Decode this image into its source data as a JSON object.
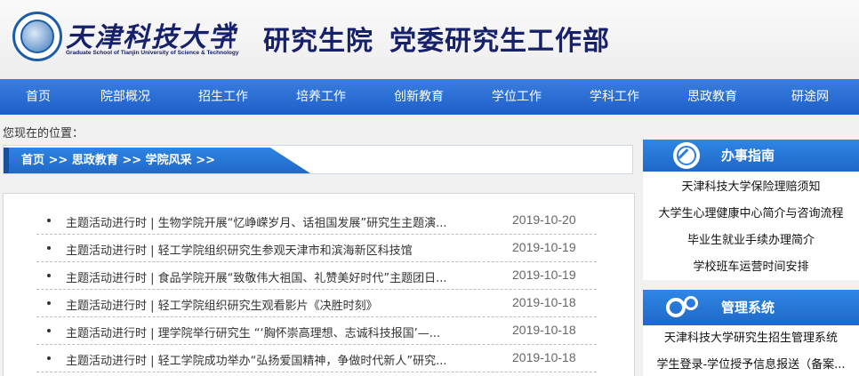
{
  "header": {
    "logo_text": "天津科技大学",
    "logo_subtitle": "Graduate School of Tianjin University of Science & Technology",
    "divider": "|",
    "site_title_1": "研究生院",
    "site_title_2": "党委研究生工作部"
  },
  "nav": {
    "items": [
      {
        "label": "首页"
      },
      {
        "label": "院部概况"
      },
      {
        "label": "招生工作"
      },
      {
        "label": "培养工作"
      },
      {
        "label": "创新教育"
      },
      {
        "label": "学位工作"
      },
      {
        "label": "学科工作"
      },
      {
        "label": "思政教育"
      },
      {
        "label": "研途网"
      }
    ]
  },
  "location": {
    "label": "您现在的位置："
  },
  "breadcrumb": {
    "text": "首页 >> 思政教育 >> 学院风采 >>"
  },
  "news": [
    {
      "title": "主题活动进行时 | 生物学院开展“忆峥嵘岁月、话祖国发展”研究生主题演...",
      "date": "2019-10-20"
    },
    {
      "title": "主题活动进行时 | 轻工学院组织研究生参观天津市和滨海新区科技馆",
      "date": "2019-10-19"
    },
    {
      "title": "主题活动进行时 | 食品学院开展“致敬伟大祖国、礼赞美好时代”主题团日...",
      "date": "2019-10-19"
    },
    {
      "title": "主题活动进行时 | 轻工学院组织研究生观看影片《决胜时刻》",
      "date": "2019-10-18"
    },
    {
      "title": "主题活动进行时 | 理学院举行研究生 “‘胸怀崇高理想、志诚科技报国’—...",
      "date": "2019-10-18"
    },
    {
      "title": "主题活动进行时 | 轻工学院成功举办“弘扬爱国精神，争做时代新人”研究...",
      "date": "2019-10-18"
    }
  ],
  "guide": {
    "title": "办事指南",
    "icon": "compass-icon",
    "links": [
      {
        "label": "天津科技大学保险理赔须知"
      },
      {
        "label": "大学生心理健康中心简介与咨询流程"
      },
      {
        "label": "毕业生就业手续办理简介"
      },
      {
        "label": "学校班车运营时间安排"
      }
    ]
  },
  "systems": {
    "title": "管理系统",
    "icon": "gears-icon",
    "links": [
      {
        "label": "天津科技大学研究生招生管理系统"
      },
      {
        "label": "学生登录-学位授予信息报送（备案..."
      }
    ]
  },
  "colors": {
    "nav_blue": "#2a6fd6",
    "title_navy": "#16206b"
  }
}
